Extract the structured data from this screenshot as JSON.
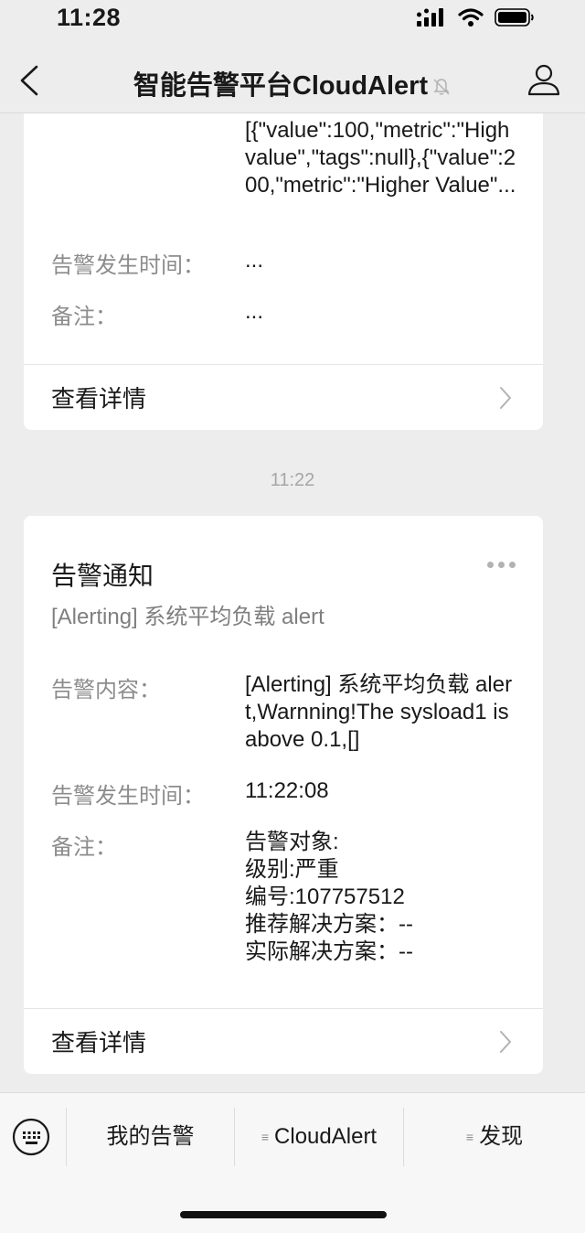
{
  "status_bar": {
    "time": "11:28"
  },
  "nav": {
    "title": "智能告警平台CloudAlert"
  },
  "cards": [
    {
      "rows": [
        {
          "label": "",
          "value": "[{\"value\":100,\"metric\":\"High value\",\"tags\":null},{\"value\":200,\"metric\":\"Higher Value\"..."
        },
        {
          "label": "告警发生时间：",
          "value": "..."
        },
        {
          "label": "备注：",
          "value": "..."
        }
      ],
      "detail_label": "查看详情"
    },
    {
      "title": "告警通知",
      "subtitle": "[Alerting] 系统平均负载 alert",
      "rows": [
        {
          "label": "告警内容：",
          "value": "[Alerting] 系统平均负载 alert,Warnning!The sysload1 is above 0.1,[]"
        },
        {
          "label": "告警发生时间：",
          "value": "11:22:08"
        },
        {
          "label": "备注：",
          "lines": [
            "告警对象:",
            "级别:严重",
            "编号:107757512",
            "推荐解决方案：--",
            "实际解决方案：--"
          ]
        }
      ],
      "detail_label": "查看详情"
    }
  ],
  "timestamp": "11:22",
  "bottom_menu": {
    "items": [
      {
        "label": "我的告警",
        "has_submenu": false
      },
      {
        "label": "CloudAlert",
        "has_submenu": true
      },
      {
        "label": "发现",
        "has_submenu": true
      }
    ],
    "submenu_glyph": "≡"
  },
  "icons": {
    "back": "chevron-left-icon",
    "mute": "bell-slash-icon",
    "profile": "person-icon",
    "more": "ellipsis-icon",
    "chevron": "chevron-right-icon",
    "keyboard": "keyboard-icon"
  },
  "colors": {
    "background": "#ededed",
    "card": "#ffffff",
    "label": "#8c8c8c",
    "text": "#191919"
  }
}
